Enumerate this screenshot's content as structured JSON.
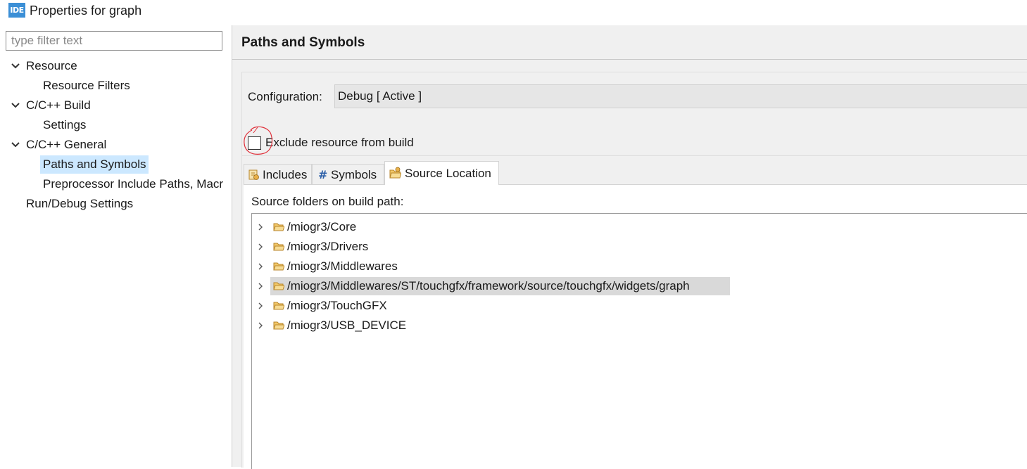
{
  "window": {
    "icon_text": "IDE",
    "title": "Properties for graph"
  },
  "sidebar": {
    "filter_placeholder": "type filter text",
    "items": [
      {
        "label": "Resource",
        "expanded": true
      },
      {
        "label": "Resource Filters"
      },
      {
        "label": "C/C++ Build",
        "expanded": true
      },
      {
        "label": "Settings"
      },
      {
        "label": "C/C++ General",
        "expanded": true
      },
      {
        "label": "Paths and Symbols",
        "selected": true
      },
      {
        "label": "Preprocessor Include Paths, Macr"
      },
      {
        "label": "Run/Debug Settings"
      }
    ]
  },
  "main": {
    "page_title": "Paths and Symbols",
    "configuration_label": "Configuration:",
    "configuration_value": "Debug  [ Active ]",
    "exclude_label": "Exclude resource from build",
    "exclude_checked": false,
    "tabs": [
      {
        "label": "Includes",
        "icon": "includes-icon"
      },
      {
        "label": "Symbols",
        "icon": "hash-icon"
      },
      {
        "label": "Source Location",
        "icon": "source-folder-icon",
        "active": true
      }
    ],
    "folders_label": "Source folders on build path:",
    "folders": [
      {
        "path": "/miogr3/Core"
      },
      {
        "path": "/miogr3/Drivers"
      },
      {
        "path": "/miogr3/Middlewares"
      },
      {
        "path": "/miogr3/Middlewares/ST/touchgfx/framework/source/touchgfx/widgets/graph",
        "selected": true
      },
      {
        "path": "/miogr3/TouchGFX"
      },
      {
        "path": "/miogr3/USB_DEVICE"
      }
    ]
  },
  "colors": {
    "selection": "#cce8ff",
    "row_selected": "#d9d9d9",
    "app_icon": "#3b8fd6",
    "annotation_circle": "#e0303a",
    "folder": "#e8b04a"
  }
}
